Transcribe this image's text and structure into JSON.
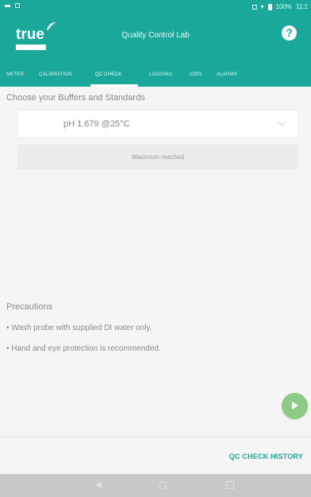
{
  "status_bar": {
    "battery": "100%",
    "time": "11:1",
    "icons": [
      "notification-icon",
      "vibrate-icon",
      "wifi-icon",
      "battery-icon"
    ]
  },
  "app_bar": {
    "logo_text": "true",
    "title": "Quality Control Lab",
    "help_icon": "?"
  },
  "tabs": [
    {
      "label": "METER"
    },
    {
      "label": "CALIBRATION"
    },
    {
      "label": "QC CHECK",
      "active": true
    },
    {
      "label": "LOGGING"
    },
    {
      "label": "JOBS"
    },
    {
      "label": "ALARMS"
    }
  ],
  "qc": {
    "section_title": "Choose your Buffers and Standards",
    "selected_buffer": "pH 1.679  @25°C",
    "max_button": "Maximum reached"
  },
  "precautions": {
    "title": "Precautions",
    "items": [
      "• Wash probe with supplied DI water only.",
      "• Hand and eye protection is recommended."
    ]
  },
  "bottom": {
    "history_link": "QC CHECK HISTORY"
  },
  "colors": {
    "primary": "#1aa89a",
    "fab": "#8ccb86",
    "background": "#f5f5f5"
  }
}
